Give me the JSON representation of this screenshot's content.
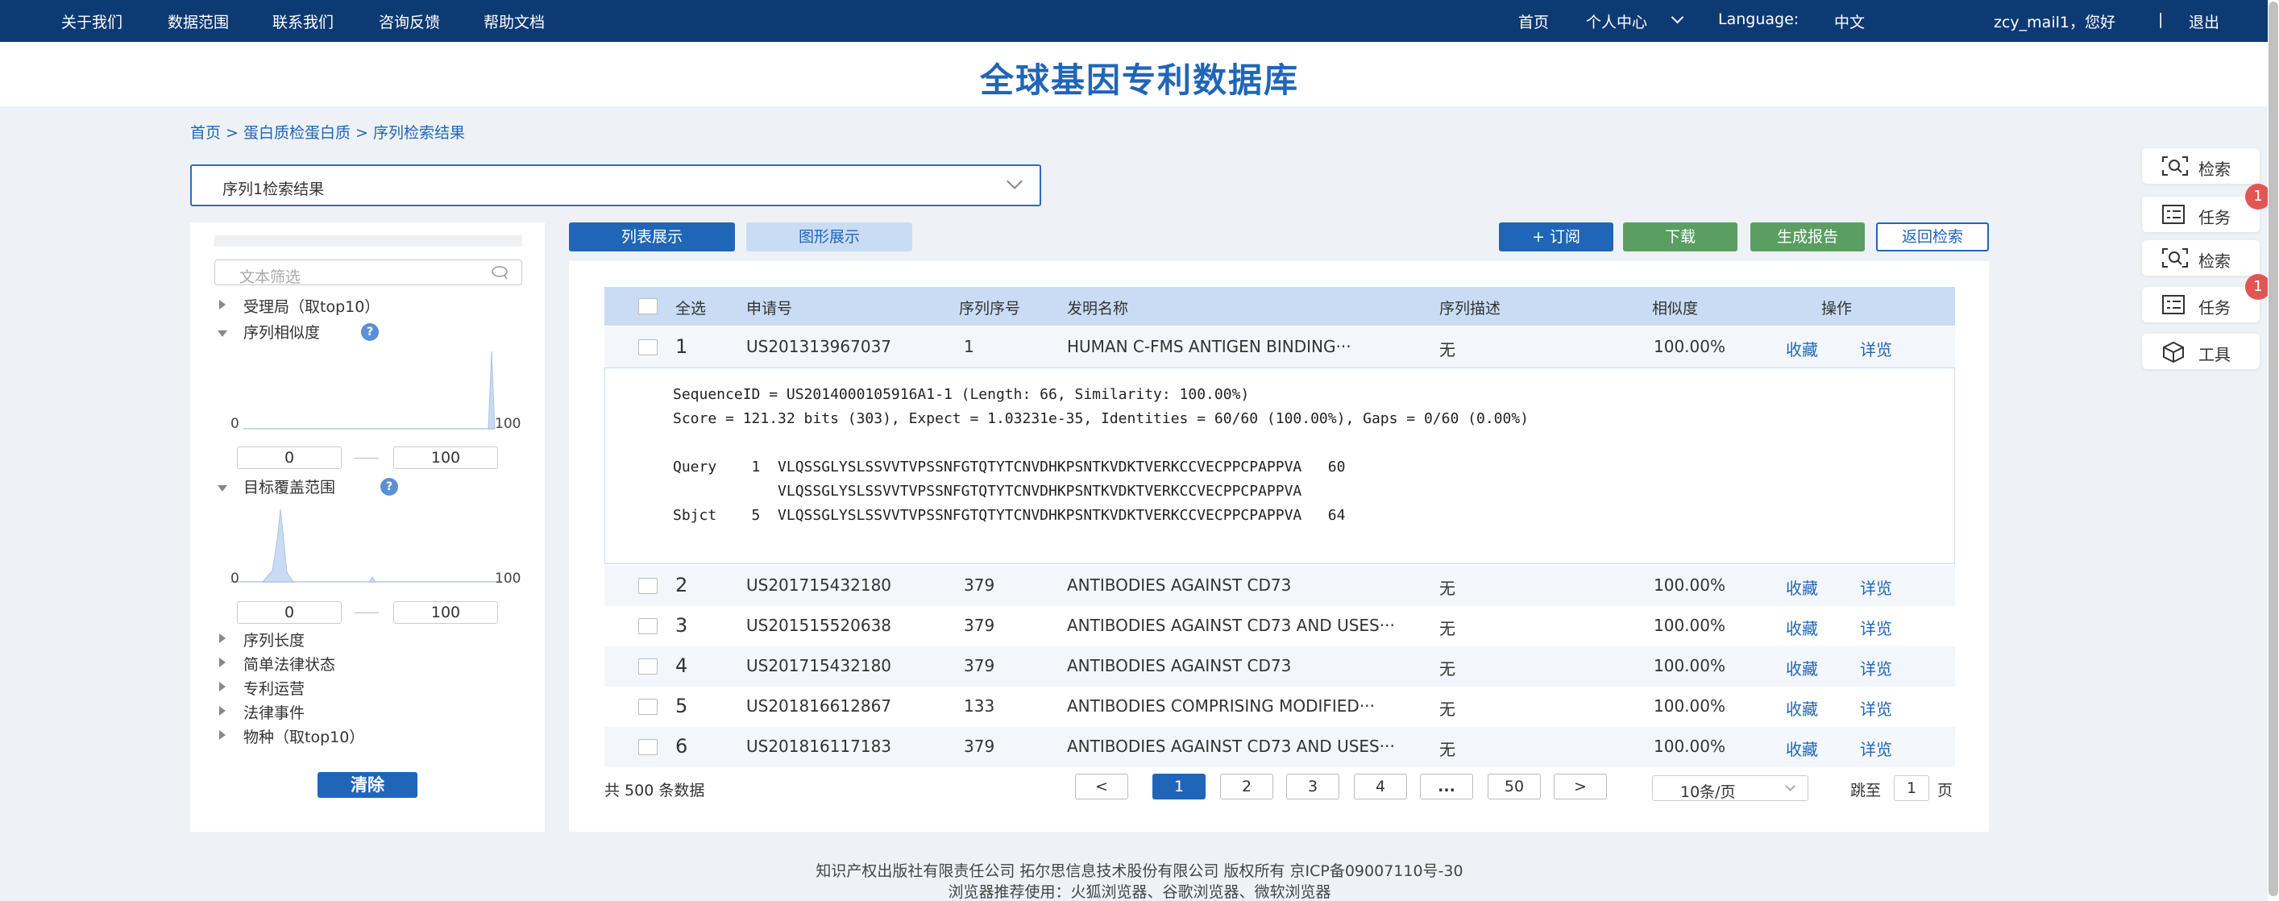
{
  "nav": {
    "left": [
      "关于我们",
      "数据范围",
      "联系我们",
      "咨询反馈",
      "帮助文档"
    ],
    "home": "首页",
    "personal": "个人中心",
    "language_label": "Language:",
    "language_value": "中文",
    "greeting": "zcy_mail1，您好",
    "separator": "|",
    "logout": "退出"
  },
  "title": "全球基因专利数据库",
  "breadcrumb": "首页 > 蛋白质检蛋白质 > 序列检索结果",
  "sequence_select": {
    "value": "序列1检索结果"
  },
  "filter": {
    "search_placeholder": "文本筛选",
    "office": "受理局（取top10）",
    "similarity": "序列相似度",
    "similarity_axis": {
      "min": "0",
      "max": "100"
    },
    "similarity_range": {
      "from": "0",
      "to": "100"
    },
    "coverage": "目标覆盖范围",
    "coverage_axis": {
      "min": "0",
      "max": "100"
    },
    "coverage_range": {
      "from": "0",
      "to": "100"
    },
    "seq_length": "序列长度",
    "legal_status": "简单法律状态",
    "operation": "专利运营",
    "legal_event": "法律事件",
    "species": "物种（取top10）",
    "help_glyph": "?",
    "clear": "清除"
  },
  "tabs": {
    "list": "列表展示",
    "graph": "图形展示"
  },
  "actions": {
    "subscribe": "+ 订阅",
    "download": "下载",
    "report": "生成报告",
    "back": "返回检索"
  },
  "table": {
    "headers": {
      "select_all": "全选",
      "app_no": "申请号",
      "seq_no": "序列序号",
      "title": "发明名称",
      "desc": "序列描述",
      "similarity": "相似度",
      "ops": "操作"
    },
    "rows": [
      {
        "idx": "1",
        "app_no": "US201313967037",
        "seq_no": "1",
        "title": "HUMAN C-FMS ANTIGEN BINDING···",
        "desc": "无",
        "similarity": "100.00%",
        "fav": "收藏",
        "detail": "详览"
      },
      {
        "idx": "2",
        "app_no": "US201715432180",
        "seq_no": "379",
        "title": "ANTIBODIES AGAINST CD73",
        "desc": "无",
        "similarity": "100.00%",
        "fav": "收藏",
        "detail": "详览"
      },
      {
        "idx": "3",
        "app_no": "US201515520638",
        "seq_no": "379",
        "title": "ANTIBODIES AGAINST CD73 AND USES···",
        "desc": "无",
        "similarity": "100.00%",
        "fav": "收藏",
        "detail": "详览"
      },
      {
        "idx": "4",
        "app_no": "US201715432180",
        "seq_no": "379",
        "title": "ANTIBODIES AGAINST CD73",
        "desc": "无",
        "similarity": "100.00%",
        "fav": "收藏",
        "detail": "详览"
      },
      {
        "idx": "5",
        "app_no": "US201816612867",
        "seq_no": "133",
        "title": "ANTIBODIES COMPRISING MODIFIED···",
        "desc": "无",
        "similarity": "100.00%",
        "fav": "收藏",
        "detail": "详览"
      },
      {
        "idx": "6",
        "app_no": "US201816117183",
        "seq_no": "379",
        "title": "ANTIBODIES AGAINST CD73 AND USES···",
        "desc": "无",
        "similarity": "100.00%",
        "fav": "收藏",
        "detail": "详览"
      }
    ]
  },
  "alignment": {
    "line1": "SequenceID = US2014000105916A1-1 (Length: 66, Similarity: 100.00%)",
    "line2": "Score = 121.32 bits (303), Expect = 1.03231e-35, Identities = 60/60 (100.00%), Gaps = 0/60 (0.00%)",
    "query": "Query    1  VLQSSGLYSLSSVVTVPSSNFGTQTYTCNVDHKPSNTKVDKTVERKCCVECPPCPAPPVA   60",
    "match": "            VLQSSGLYSLSSVVTVPSSNFGTQTYTCNVDHKPSNTKVDKTVERKCCVECPPCPAPPVA",
    "sbjct": "Sbjct    5  VLQSSGLYSLSSVVTVPSSNFGTQTYTCNVDHKPSNTKVDKTVERKCCVECPPCPAPPVA   64"
  },
  "pagination": {
    "total": "共 500 条数据",
    "prev": "<",
    "pages": [
      "1",
      "2",
      "3",
      "4",
      "...",
      "50"
    ],
    "next": ">",
    "page_size": "10条/页",
    "jump_label": "跳至",
    "jump_value": "1",
    "jump_unit": "页"
  },
  "tools": {
    "search1": "检索",
    "task1": "任务",
    "task1_badge": "1",
    "search2": "检索",
    "task2": "任务",
    "task2_badge": "1",
    "tool": "工具"
  },
  "footer": {
    "line1": "知识产权出版社有限责任公司 拓尔思信息技术股份有限公司 版权所有 京ICP备09007110号-30",
    "line2": "浏览器推荐使用：火狐浏览器、谷歌浏览器、微软浏览器"
  },
  "colors": {
    "nav_bg": "#0e3a74",
    "primary": "#1f66b8",
    "green": "#5a9e62",
    "badge": "#e35555"
  }
}
